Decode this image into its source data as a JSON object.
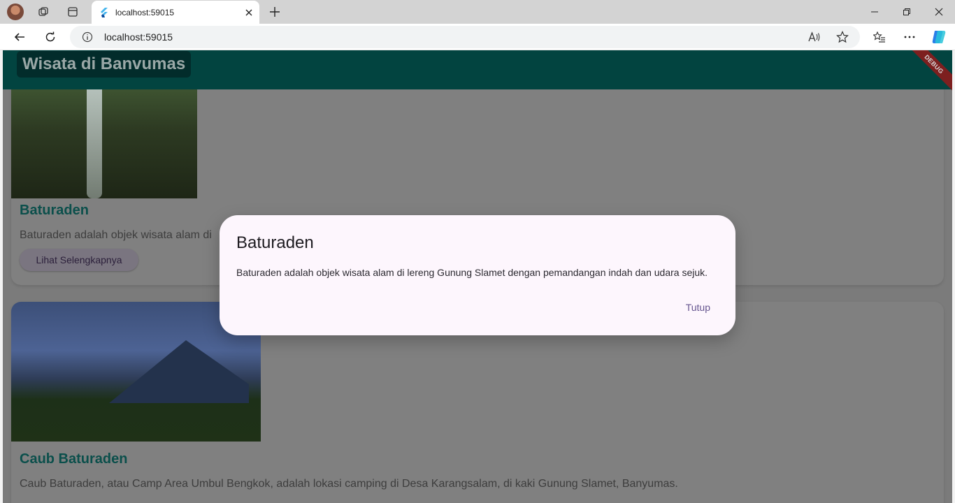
{
  "browser": {
    "tab_title": "localhost:59015",
    "address": "localhost:59015"
  },
  "app": {
    "title": "Wisata di Banvumas",
    "debug_banner": "DEBUG"
  },
  "cards": [
    {
      "title": "Baturaden",
      "description": "Baturaden adalah objek wisata alam di",
      "button_label": "Lihat Selengkapnya"
    },
    {
      "title": "Caub Baturaden",
      "description": "Caub Baturaden, atau Camp Area Umbul Bengkok, adalah lokasi camping di Desa Karangsalam, di kaki Gunung Slamet, Banyumas."
    }
  ],
  "dialog": {
    "title": "Baturaden",
    "body": "Baturaden adalah objek wisata alam di lereng Gunung Slamet dengan pemandangan indah dan udara sejuk.",
    "close_label": "Tutup"
  },
  "colors": {
    "appbar": "#024440",
    "accent_title": "#0b4f4b",
    "dialog_bg": "#fdf6fd",
    "dialog_button": "#65558f"
  }
}
